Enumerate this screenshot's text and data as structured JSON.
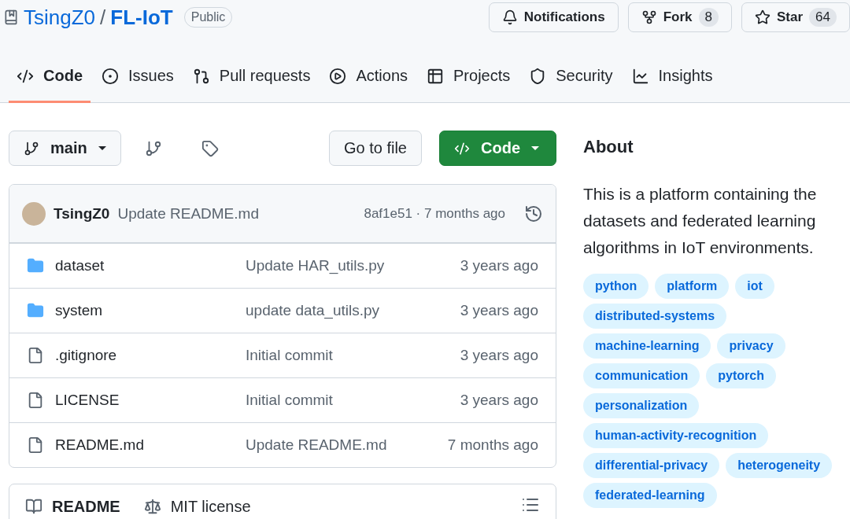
{
  "repo": {
    "owner": "TsingZ0",
    "separator": "/",
    "name": "FL-IoT",
    "visibility": "Public"
  },
  "actions": [
    {
      "kind": "notifications",
      "label": "Notifications"
    },
    {
      "kind": "fork",
      "label": "Fork",
      "count": "8"
    },
    {
      "kind": "star",
      "label": "Star",
      "count": "64"
    }
  ],
  "tabs": [
    {
      "kind": "code",
      "label": "Code",
      "selected": true
    },
    {
      "kind": "issues",
      "label": "Issues",
      "selected": false
    },
    {
      "kind": "pulls",
      "label": "Pull requests",
      "selected": false
    },
    {
      "kind": "actions",
      "label": "Actions",
      "selected": false
    },
    {
      "kind": "projects",
      "label": "Projects",
      "selected": false
    },
    {
      "kind": "security",
      "label": "Security",
      "selected": false
    },
    {
      "kind": "insights",
      "label": "Insights",
      "selected": false
    }
  ],
  "toolbar": {
    "branch": "main",
    "go_to_file": "Go to file",
    "code_button": "Code"
  },
  "commit": {
    "author": "TsingZ0",
    "message": "Update README.md",
    "hash_time": "8af1e51 · 7 months ago"
  },
  "files": [
    {
      "kind": "folder",
      "name": "dataset",
      "message": "Update HAR_utils.py",
      "time": "3 years ago"
    },
    {
      "kind": "folder",
      "name": "system",
      "message": "update data_utils.py",
      "time": "3 years ago"
    },
    {
      "kind": "file",
      "name": ".gitignore",
      "message": "Initial commit",
      "time": "3 years ago"
    },
    {
      "kind": "file",
      "name": "LICENSE",
      "message": "Initial commit",
      "time": "3 years ago"
    },
    {
      "kind": "file",
      "name": "README.md",
      "message": "Update README.md",
      "time": "7 months ago"
    }
  ],
  "readme_tabs": [
    {
      "kind": "readme",
      "label": "README",
      "selected": true
    },
    {
      "kind": "license",
      "label": "MIT license",
      "selected": false
    }
  ],
  "about": {
    "title": "About",
    "description": "This is a platform containing the datasets and federated learning algorithms in IoT environments.",
    "topics": [
      "python",
      "platform",
      "iot",
      "distributed-systems",
      "machine-learning",
      "privacy",
      "communication",
      "pytorch",
      "personalization",
      "human-activity-recognition",
      "differential-privacy",
      "heterogeneity",
      "federated-learning"
    ]
  }
}
